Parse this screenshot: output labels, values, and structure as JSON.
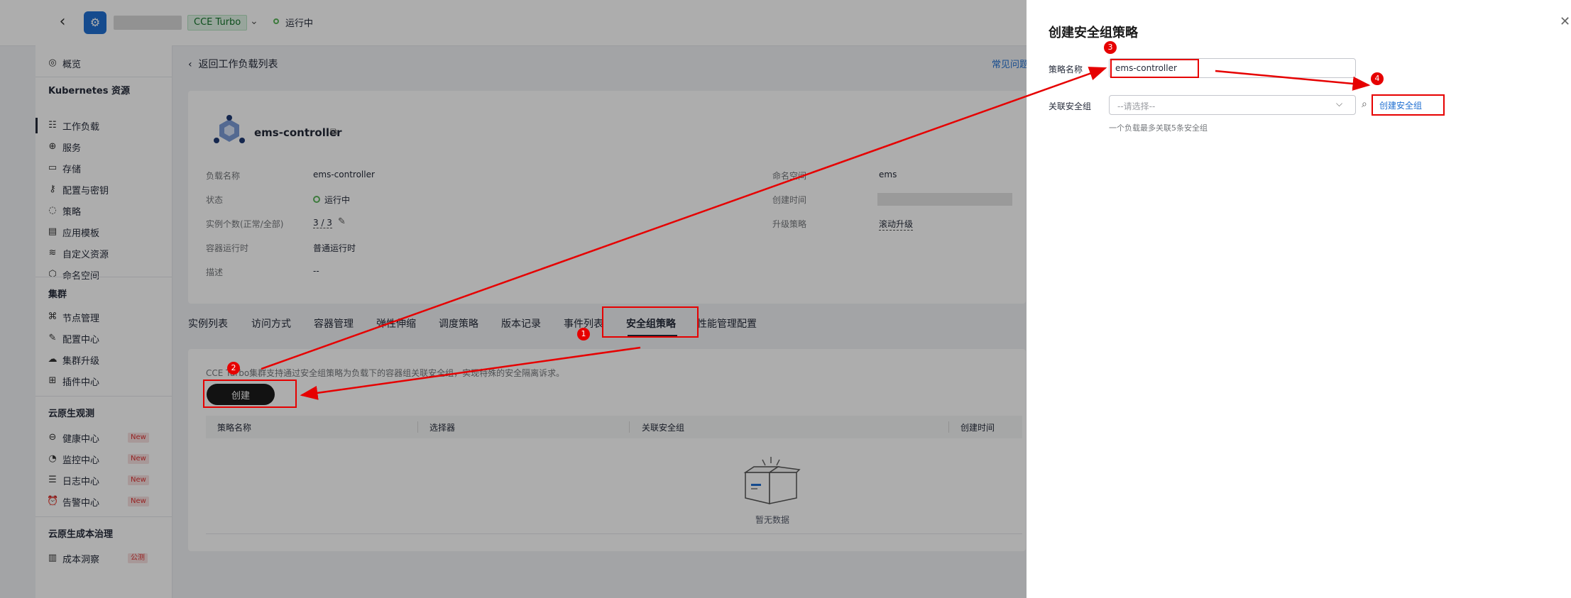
{
  "header": {
    "cluster_type_badge": "CCE Turbo",
    "cluster_status": "运行中"
  },
  "sidebar": {
    "overview": "概览",
    "groups": [
      {
        "title": "Kubernetes 资源",
        "items": [
          "工作负载",
          "服务",
          "存储",
          "配置与密钥",
          "策略",
          "应用模板",
          "自定义资源",
          "命名空间"
        ]
      },
      {
        "title": "集群",
        "items": [
          "节点管理",
          "配置中心",
          "集群升级",
          "插件中心"
        ]
      },
      {
        "title": "云原生观测",
        "items": [
          "健康中心",
          "监控中心",
          "日志中心",
          "告警中心"
        ]
      },
      {
        "title": "云原生成本治理",
        "items": [
          "成本洞察"
        ]
      }
    ],
    "new_badge": "New",
    "beta_badge": "公测"
  },
  "main": {
    "back_link": "返回工作负载列表",
    "faq_link": "常见问题",
    "workload_name": "ems-controller",
    "fields": {
      "name_label": "负载名称",
      "name_value": "ems-controller",
      "status_label": "状态",
      "status_value": "运行中",
      "replicas_label": "实例个数(正常/全部)",
      "replicas_value": "3 / 3",
      "runtime_label": "容器运行时",
      "runtime_value": "普通运行时",
      "desc_label": "描述",
      "desc_value": "--",
      "ns_label": "命名空间",
      "ns_value": "ems",
      "created_label": "创建时间",
      "upgrade_label": "升级策略",
      "upgrade_value": "滚动升级"
    },
    "tabs": [
      "实例列表",
      "访问方式",
      "容器管理",
      "弹性伸缩",
      "调度策略",
      "版本记录",
      "事件列表",
      "安全组策略",
      "性能管理配置"
    ],
    "policy_desc": "CCE Turbo集群支持通过安全组策略为负载下的容器组关联安全组，实现特殊的安全隔离诉求。",
    "create_button": "创建",
    "table_columns": [
      "策略名称",
      "选择器",
      "关联安全组",
      "创建时间"
    ],
    "empty_text": "暂无数据"
  },
  "drawer": {
    "title": "创建安全组策略",
    "policy_name_label": "策略名称",
    "policy_name_value": "ems-controller",
    "sg_label": "关联安全组",
    "sg_placeholder": "--请选择--",
    "create_sg_link": "创建安全组",
    "sg_hint": "一个负载最多关联5条安全组"
  },
  "annotations": {
    "markers": [
      "1",
      "2",
      "3",
      "4"
    ],
    "color": "#e60000"
  }
}
